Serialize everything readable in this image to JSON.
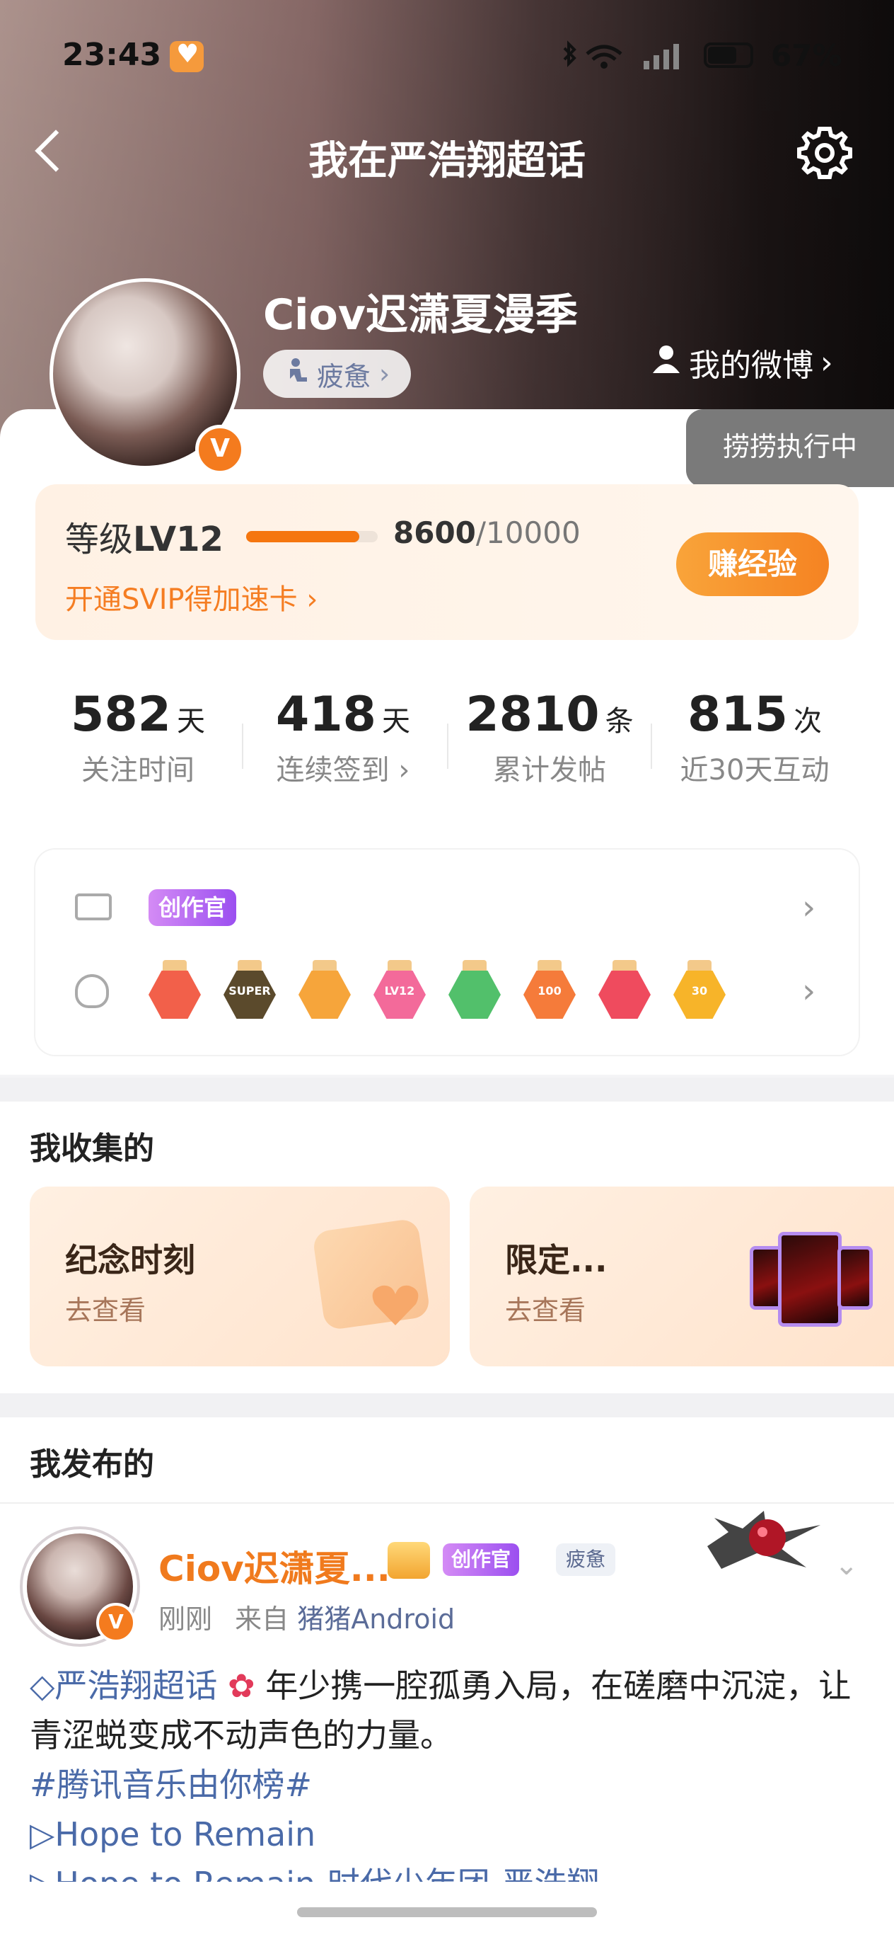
{
  "status_bar": {
    "time": "23:43",
    "battery": "67%"
  },
  "header": {
    "title": "我在严浩翔超话"
  },
  "profile": {
    "username": "Ciov迟潇夏漫季",
    "mood": "疲惫",
    "my_weibo": "我的微博",
    "running_tip": "捞捞执行中",
    "verified_mark": "V"
  },
  "level": {
    "label_prefix": "等级",
    "level": "LV12",
    "current_exp": "8600",
    "max_exp": "/10000",
    "progress": 0.86,
    "svip_link": "开通SVIP得加速卡 ›",
    "earn_button": "赚经验"
  },
  "stats": [
    {
      "value": "582",
      "unit": "天",
      "label": "关注时间"
    },
    {
      "value": "418",
      "unit": "天",
      "label": "连续签到 ›"
    },
    {
      "value": "2810",
      "unit": "条",
      "label": "累计发帖"
    },
    {
      "value": "815",
      "unit": "次",
      "label": "近30天互动"
    }
  ],
  "honors": {
    "creator_tag": "创作官",
    "medals": [
      {
        "name": "fox-medal",
        "color": "#f2604a",
        "text": ""
      },
      {
        "name": "super-medal",
        "color": "#5b4a2c",
        "text": "SUPER"
      },
      {
        "name": "crown-medal",
        "color": "#f6a53b",
        "text": ""
      },
      {
        "name": "lv12-medal",
        "color": "#f36a9a",
        "text": "LV12"
      },
      {
        "name": "hand-medal",
        "color": "#52c06b",
        "text": ""
      },
      {
        "name": "100-days-medal",
        "color": "#f57b3a",
        "text": "100"
      },
      {
        "name": "trophy-medal",
        "color": "#ef4b5e",
        "text": ""
      },
      {
        "name": "30-days-medal",
        "color": "#f7b429",
        "text": "30"
      }
    ]
  },
  "collected": {
    "title": "我收集的",
    "cards": [
      {
        "title": "纪念时刻",
        "sub": "去查看"
      },
      {
        "title": "限定...",
        "sub": "去查看"
      }
    ]
  },
  "published": {
    "title": "我发布的",
    "post": {
      "name": "Ciov迟潇夏...",
      "creator_tag": "创作官",
      "mood_tag": "疲惫",
      "time": "刚刚",
      "from": "来自",
      "device": "猪猪Android",
      "topic": "严浩翔超话",
      "text": "年少携一腔孤勇入局，在磋磨中沉淀，让青涩蜕变成不动声色的力量。",
      "hashtag": "#腾讯音乐由你榜#",
      "line1": "▷Hope to Remain",
      "line2": "▷Hope to Remain-时代少年团-严浩翔"
    }
  },
  "colors": {
    "accent": "#f5760f",
    "link": "#4a6aa8",
    "creator": "#9b4ff0"
  }
}
